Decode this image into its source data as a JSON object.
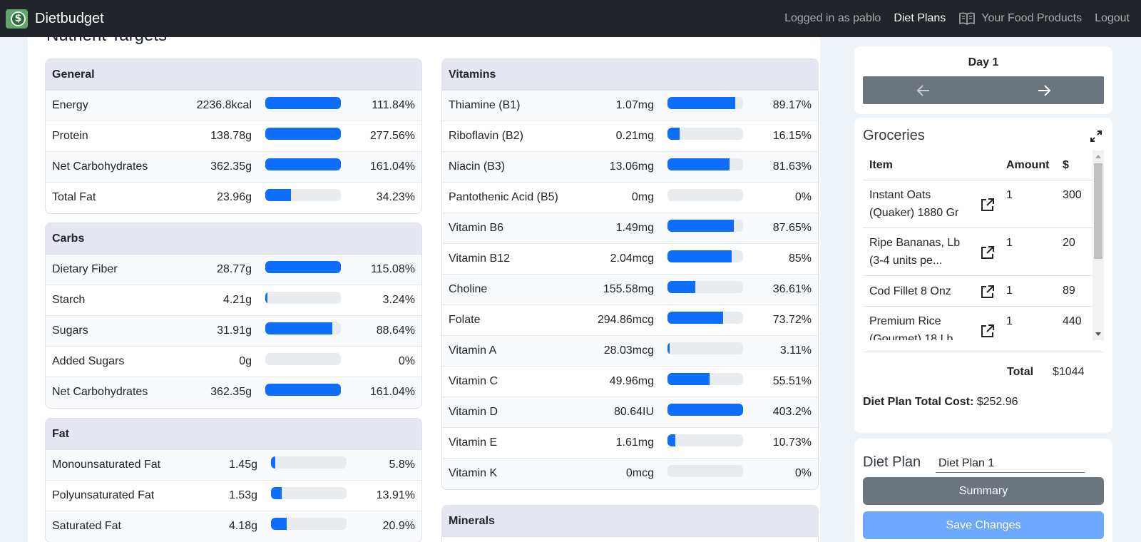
{
  "navbar": {
    "brand": "Dietbudget",
    "logged_in": "Logged in as pablo",
    "diet_plans": "Diet Plans",
    "food_products": "Your Food Products",
    "logout": "Logout"
  },
  "page": {
    "heading": "Nutrient Targets"
  },
  "general": {
    "title": "General",
    "rows": [
      {
        "name": "Energy",
        "amount": "2236.8kcal",
        "pct": "111.84%",
        "level": 111.84
      },
      {
        "name": "Protein",
        "amount": "138.78g",
        "pct": "277.56%",
        "level": 277.56
      },
      {
        "name": "Net Carbohydrates",
        "amount": "362.35g",
        "pct": "161.04%",
        "level": 161.04
      },
      {
        "name": "Total Fat",
        "amount": "23.96g",
        "pct": "34.23%",
        "level": 34.23
      }
    ]
  },
  "carbs": {
    "title": "Carbs",
    "rows": [
      {
        "name": "Dietary Fiber",
        "amount": "28.77g",
        "pct": "115.08%",
        "level": 115.08
      },
      {
        "name": "Starch",
        "amount": "4.21g",
        "pct": "3.24%",
        "level": 3.24
      },
      {
        "name": "Sugars",
        "amount": "31.91g",
        "pct": "88.64%",
        "level": 88.64
      },
      {
        "name": "Added Sugars",
        "amount": "0g",
        "pct": "0%",
        "level": 0
      },
      {
        "name": "Net Carbohydrates",
        "amount": "362.35g",
        "pct": "161.04%",
        "level": 161.04
      }
    ]
  },
  "fat": {
    "title": "Fat",
    "rows": [
      {
        "name": "Monounsaturated Fat",
        "amount": "1.45g",
        "pct": "5.8%",
        "level": 5.8
      },
      {
        "name": "Polyunsaturated Fat",
        "amount": "1.53g",
        "pct": "13.91%",
        "level": 13.91
      },
      {
        "name": "Saturated Fat",
        "amount": "4.18g",
        "pct": "20.9%",
        "level": 20.9
      }
    ]
  },
  "vitamins": {
    "title": "Vitamins",
    "rows": [
      {
        "name": "Thiamine (B1)",
        "amount": "1.07mg",
        "pct": "89.17%",
        "level": 89.17
      },
      {
        "name": "Riboflavin (B2)",
        "amount": "0.21mg",
        "pct": "16.15%",
        "level": 16.15
      },
      {
        "name": "Niacin (B3)",
        "amount": "13.06mg",
        "pct": "81.63%",
        "level": 81.63
      },
      {
        "name": "Pantothenic Acid (B5)",
        "amount": "0mg",
        "pct": "0%",
        "level": 0
      },
      {
        "name": "Vitamin B6",
        "amount": "1.49mg",
        "pct": "87.65%",
        "level": 87.65
      },
      {
        "name": "Vitamin B12",
        "amount": "2.04mcg",
        "pct": "85%",
        "level": 85
      },
      {
        "name": "Choline",
        "amount": "155.58mg",
        "pct": "36.61%",
        "level": 36.61
      },
      {
        "name": "Folate",
        "amount": "294.86mcg",
        "pct": "73.72%",
        "level": 73.72
      },
      {
        "name": "Vitamin A",
        "amount": "28.03mcg",
        "pct": "3.11%",
        "level": 3.11
      },
      {
        "name": "Vitamin C",
        "amount": "49.96mg",
        "pct": "55.51%",
        "level": 55.51
      },
      {
        "name": "Vitamin D",
        "amount": "80.64IU",
        "pct": "403.2%",
        "level": 403.2
      },
      {
        "name": "Vitamin E",
        "amount": "1.61mg",
        "pct": "10.73%",
        "level": 10.73
      },
      {
        "name": "Vitamin K",
        "amount": "0mcg",
        "pct": "0%",
        "level": 0
      }
    ]
  },
  "minerals": {
    "title": "Minerals"
  },
  "day": {
    "title": "Day 1"
  },
  "groceries": {
    "title": "Groceries",
    "headers": {
      "item": "Item",
      "amount": "Amount",
      "price": "$"
    },
    "items": [
      {
        "name": "Instant Oats (Quaker) 1880 Gr",
        "amount": "1",
        "price": "300"
      },
      {
        "name": "Ripe Bananas, Lb (3-4 units pe...",
        "amount": "1",
        "price": "20"
      },
      {
        "name": "Cod Fillet 8 Onz",
        "amount": "1",
        "price": "89"
      },
      {
        "name": "Premium Rice (Gourmet) 18 Lb",
        "amount": "1",
        "price": "440"
      }
    ],
    "total_label": "Total",
    "total_value": "$1044",
    "plan_cost_label": "Diet Plan Total Cost:",
    "plan_cost_value": "$252.96"
  },
  "diet_plan": {
    "label": "Diet Plan",
    "name_value": "Diet Plan 1",
    "summary_label": "Summary",
    "save_label": "Save Changes"
  },
  "colors": {
    "navbar": "#212529",
    "bar_fill": "#0d6efd",
    "bar_track": "#e9ecef",
    "secondary": "#6c757d",
    "save_button": "#6ea8fe",
    "brand_icon": "#5fa66e"
  }
}
